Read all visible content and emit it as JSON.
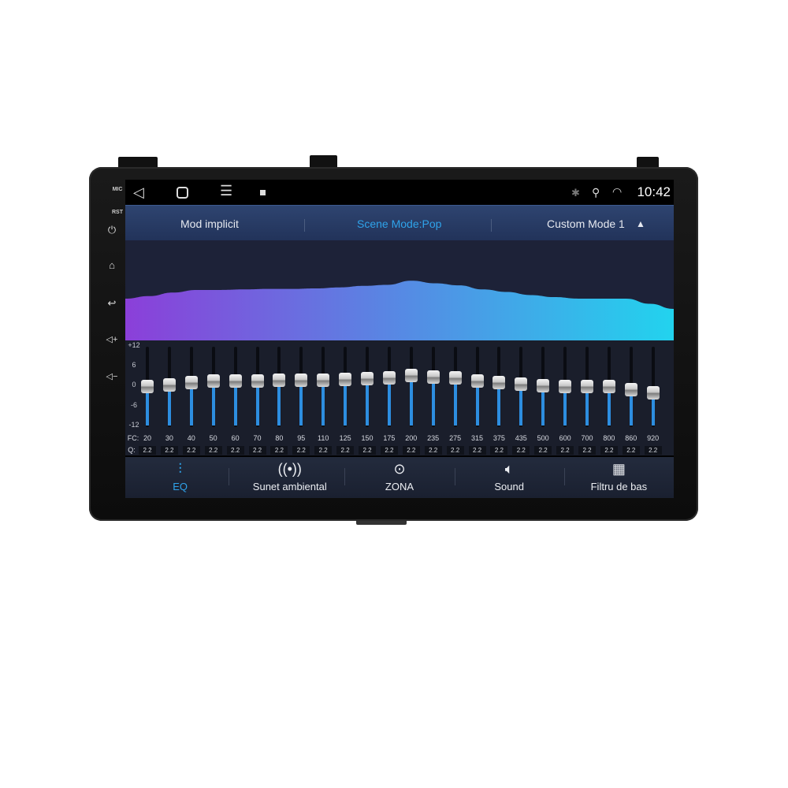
{
  "device": {
    "mic_label": "MIC",
    "rst_label": "RST",
    "buttons": [
      "power-icon",
      "home-icon",
      "back-icon",
      "volume-up-icon",
      "volume-down-icon"
    ]
  },
  "status": {
    "nav": [
      "back-icon",
      "home-icon",
      "menu-icon",
      "screenshot-icon"
    ],
    "icons": [
      "bluetooth-icon",
      "location-icon",
      "wifi-icon"
    ],
    "time": "10:42"
  },
  "modes": {
    "default": "Mod implicit",
    "scene": "Scene Mode:Pop",
    "custom": "Custom Mode 1",
    "active_color": "#2fa3ea"
  },
  "eq": {
    "scale": [
      "+12",
      "6",
      "0",
      "-6",
      "-12"
    ],
    "fc_label": "FC:",
    "q_label": "Q:",
    "bands": [
      {
        "fc": "20",
        "q": "2.2",
        "gain": 0
      },
      {
        "fc": "30",
        "q": "2.2",
        "gain": 0.5
      },
      {
        "fc": "40",
        "q": "2.2",
        "gain": 1.2
      },
      {
        "fc": "50",
        "q": "2.2",
        "gain": 1.7
      },
      {
        "fc": "60",
        "q": "2.2",
        "gain": 1.7
      },
      {
        "fc": "70",
        "q": "2.2",
        "gain": 1.8
      },
      {
        "fc": "80",
        "q": "2.2",
        "gain": 1.9
      },
      {
        "fc": "95",
        "q": "2.2",
        "gain": 1.9
      },
      {
        "fc": "110",
        "q": "2.2",
        "gain": 2
      },
      {
        "fc": "125",
        "q": "2.2",
        "gain": 2.2
      },
      {
        "fc": "150",
        "q": "2.2",
        "gain": 2.5
      },
      {
        "fc": "175",
        "q": "2.2",
        "gain": 2.7
      },
      {
        "fc": "200",
        "q": "2.2",
        "gain": 3.5
      },
      {
        "fc": "235",
        "q": "2.2",
        "gain": 3
      },
      {
        "fc": "275",
        "q": "2.2",
        "gain": 2.6
      },
      {
        "fc": "315",
        "q": "2.2",
        "gain": 1.8
      },
      {
        "fc": "375",
        "q": "2.2",
        "gain": 1.3
      },
      {
        "fc": "435",
        "q": "2.2",
        "gain": 0.7
      },
      {
        "fc": "500",
        "q": "2.2",
        "gain": 0.3
      },
      {
        "fc": "600",
        "q": "2.2",
        "gain": 0
      },
      {
        "fc": "700",
        "q": "2.2",
        "gain": 0
      },
      {
        "fc": "800",
        "q": "2.2",
        "gain": 0
      },
      {
        "fc": "860",
        "q": "2.2",
        "gain": -1
      },
      {
        "fc": "920",
        "q": "2.2",
        "gain": -2
      }
    ],
    "range": [
      -12,
      12
    ],
    "curve_colors": [
      "#8b3fd9",
      "#22d3ee"
    ]
  },
  "tabs": [
    {
      "label": "EQ",
      "icon": "equalizer-icon",
      "active": true
    },
    {
      "label": "Sunet ambiental",
      "icon": "surround-icon"
    },
    {
      "label": "ZONA",
      "icon": "zone-target-icon"
    },
    {
      "label": "Sound",
      "icon": "speaker-icon"
    },
    {
      "label": "Filtru de bas",
      "icon": "bass-filter-icon"
    }
  ]
}
